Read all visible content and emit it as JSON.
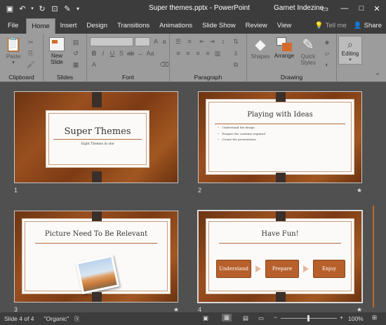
{
  "window": {
    "title": "Super themes.pptx - PowerPoint",
    "user": "Garnet Indezine"
  },
  "tabs": [
    "File",
    "Home",
    "Insert",
    "Design",
    "Transitions",
    "Animations",
    "Slide Show",
    "Review",
    "View"
  ],
  "tell_me": "Tell me",
  "share": "Share",
  "ribbon": {
    "clipboard": {
      "label": "Clipboard",
      "paste": "Paste"
    },
    "slides": {
      "label": "Slides",
      "new_slide_line1": "New",
      "new_slide_line2": "Slide"
    },
    "font": {
      "label": "Font"
    },
    "paragraph": {
      "label": "Paragraph"
    },
    "drawing": {
      "label": "Drawing",
      "shapes": "Shapes",
      "arrange": "Arrange",
      "quick_styles_line1": "Quick",
      "quick_styles_line2": "Styles"
    },
    "editing": {
      "label": "Editing"
    }
  },
  "slides": [
    {
      "number": "1",
      "title": "Super Themes",
      "subtitle": "Eight Themes in one"
    },
    {
      "number": "2",
      "title": "Playing with Ideas",
      "bullets": [
        "Understand the design",
        "Prepare the contents required",
        "Create the presentation"
      ]
    },
    {
      "number": "3",
      "title": "Picture Need To Be Relevant"
    },
    {
      "number": "4",
      "title": "Have Fun!",
      "steps": [
        "Understand",
        "Prepare",
        "Enjoy"
      ]
    }
  ],
  "status": {
    "slide_info": "Slide 4 of 4",
    "theme": "\"Organic\"",
    "zoom": "100%"
  },
  "colors": {
    "accent": "#b7602c",
    "ribbon": "#9c9c9c",
    "chrome": "#3c3c3c"
  }
}
